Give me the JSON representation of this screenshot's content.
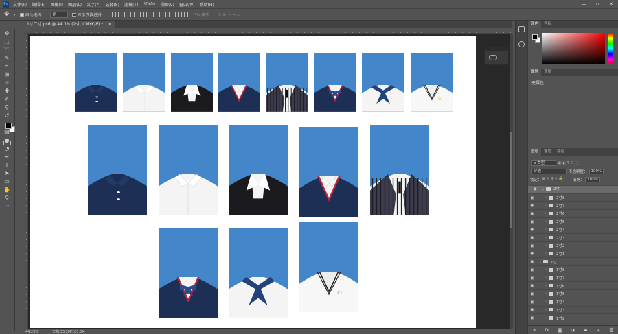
{
  "app": {
    "logo": "Ps"
  },
  "menu": [
    "文件(F)",
    "编辑(E)",
    "图像(I)",
    "图层(L)",
    "文字(Y)",
    "选择(S)",
    "滤镜(T)",
    "3D(D)",
    "视图(V)",
    "窗口(W)",
    "帮助(H)"
  ],
  "window_controls": [
    "—",
    "▫",
    "✕"
  ],
  "options_bar": {
    "auto_select_label": "自动选择：",
    "auto_select_value": "组",
    "show_transform_label": "显示变换控件",
    "mode_3d_label": "3D 模式："
  },
  "document": {
    "tab_title": "1寸二寸.psd @ 44.3% (2寸, CMYK/8) *",
    "close": "×"
  },
  "status": {
    "zoom": "44.29%",
    "doc_size": "文档:33.2M/103.0M"
  },
  "color_panel": {
    "tabs": [
      "颜色",
      "色板"
    ],
    "foreground": "#000000",
    "background": "#ffffff"
  },
  "properties_panel": {
    "tabs": [
      "属性",
      "调整"
    ],
    "text": "无属性"
  },
  "layers_panel": {
    "tabs": [
      "图层",
      "通道",
      "路径"
    ],
    "filter_label": "ρ 类型",
    "blend_mode": "穿透",
    "opacity_label": "不透明度：",
    "opacity_value": "100%",
    "lock_label": "锁定：",
    "fill_label": "填充：",
    "fill_value": "100%",
    "layers": [
      {
        "name": "2寸",
        "group": true,
        "expanded": true,
        "selected": true
      },
      {
        "name": "2寸8"
      },
      {
        "name": "2寸7"
      },
      {
        "name": "2寸6"
      },
      {
        "name": "2寸5"
      },
      {
        "name": "2寸4"
      },
      {
        "name": "2寸3"
      },
      {
        "name": "2寸2"
      },
      {
        "name": "2寸1"
      },
      {
        "name": "1寸",
        "group": true,
        "expanded": true
      },
      {
        "name": "1寸8"
      },
      {
        "name": "1寸7"
      },
      {
        "name": "1寸6"
      },
      {
        "name": "1寸5"
      },
      {
        "name": "1寸4"
      },
      {
        "name": "1寸3"
      },
      {
        "name": "1寸2"
      }
    ],
    "footer_icons": [
      "link-icon",
      "fx-icon",
      "mask-icon",
      "adjustment-icon",
      "folder-icon",
      "new-layer-icon",
      "trash-icon"
    ]
  },
  "photo_cards": [
    {
      "shirt": "navy-polo"
    },
    {
      "shirt": "white-shirt"
    },
    {
      "shirt": "black-suit"
    },
    {
      "shirt": "navy-vneck"
    },
    {
      "shirt": "striped-vest"
    },
    {
      "shirt": "navy-bowtie"
    },
    {
      "shirt": "navy-sailor-bow"
    },
    {
      "shirt": "white-vneck-sweater"
    },
    {
      "shirt": "navy-polo"
    },
    {
      "shirt": "white-shirt"
    },
    {
      "shirt": "black-suit"
    },
    {
      "shirt": "navy-vneck"
    },
    {
      "shirt": "striped-vest"
    },
    {
      "shirt": "navy-bowtie"
    },
    {
      "shirt": "navy-sailor-bow"
    },
    {
      "shirt": "white-vneck-sweater"
    }
  ],
  "colors": {
    "card_blue": "#4386c9",
    "navy": "#1d2f55",
    "red_trim": "#c0233a"
  }
}
